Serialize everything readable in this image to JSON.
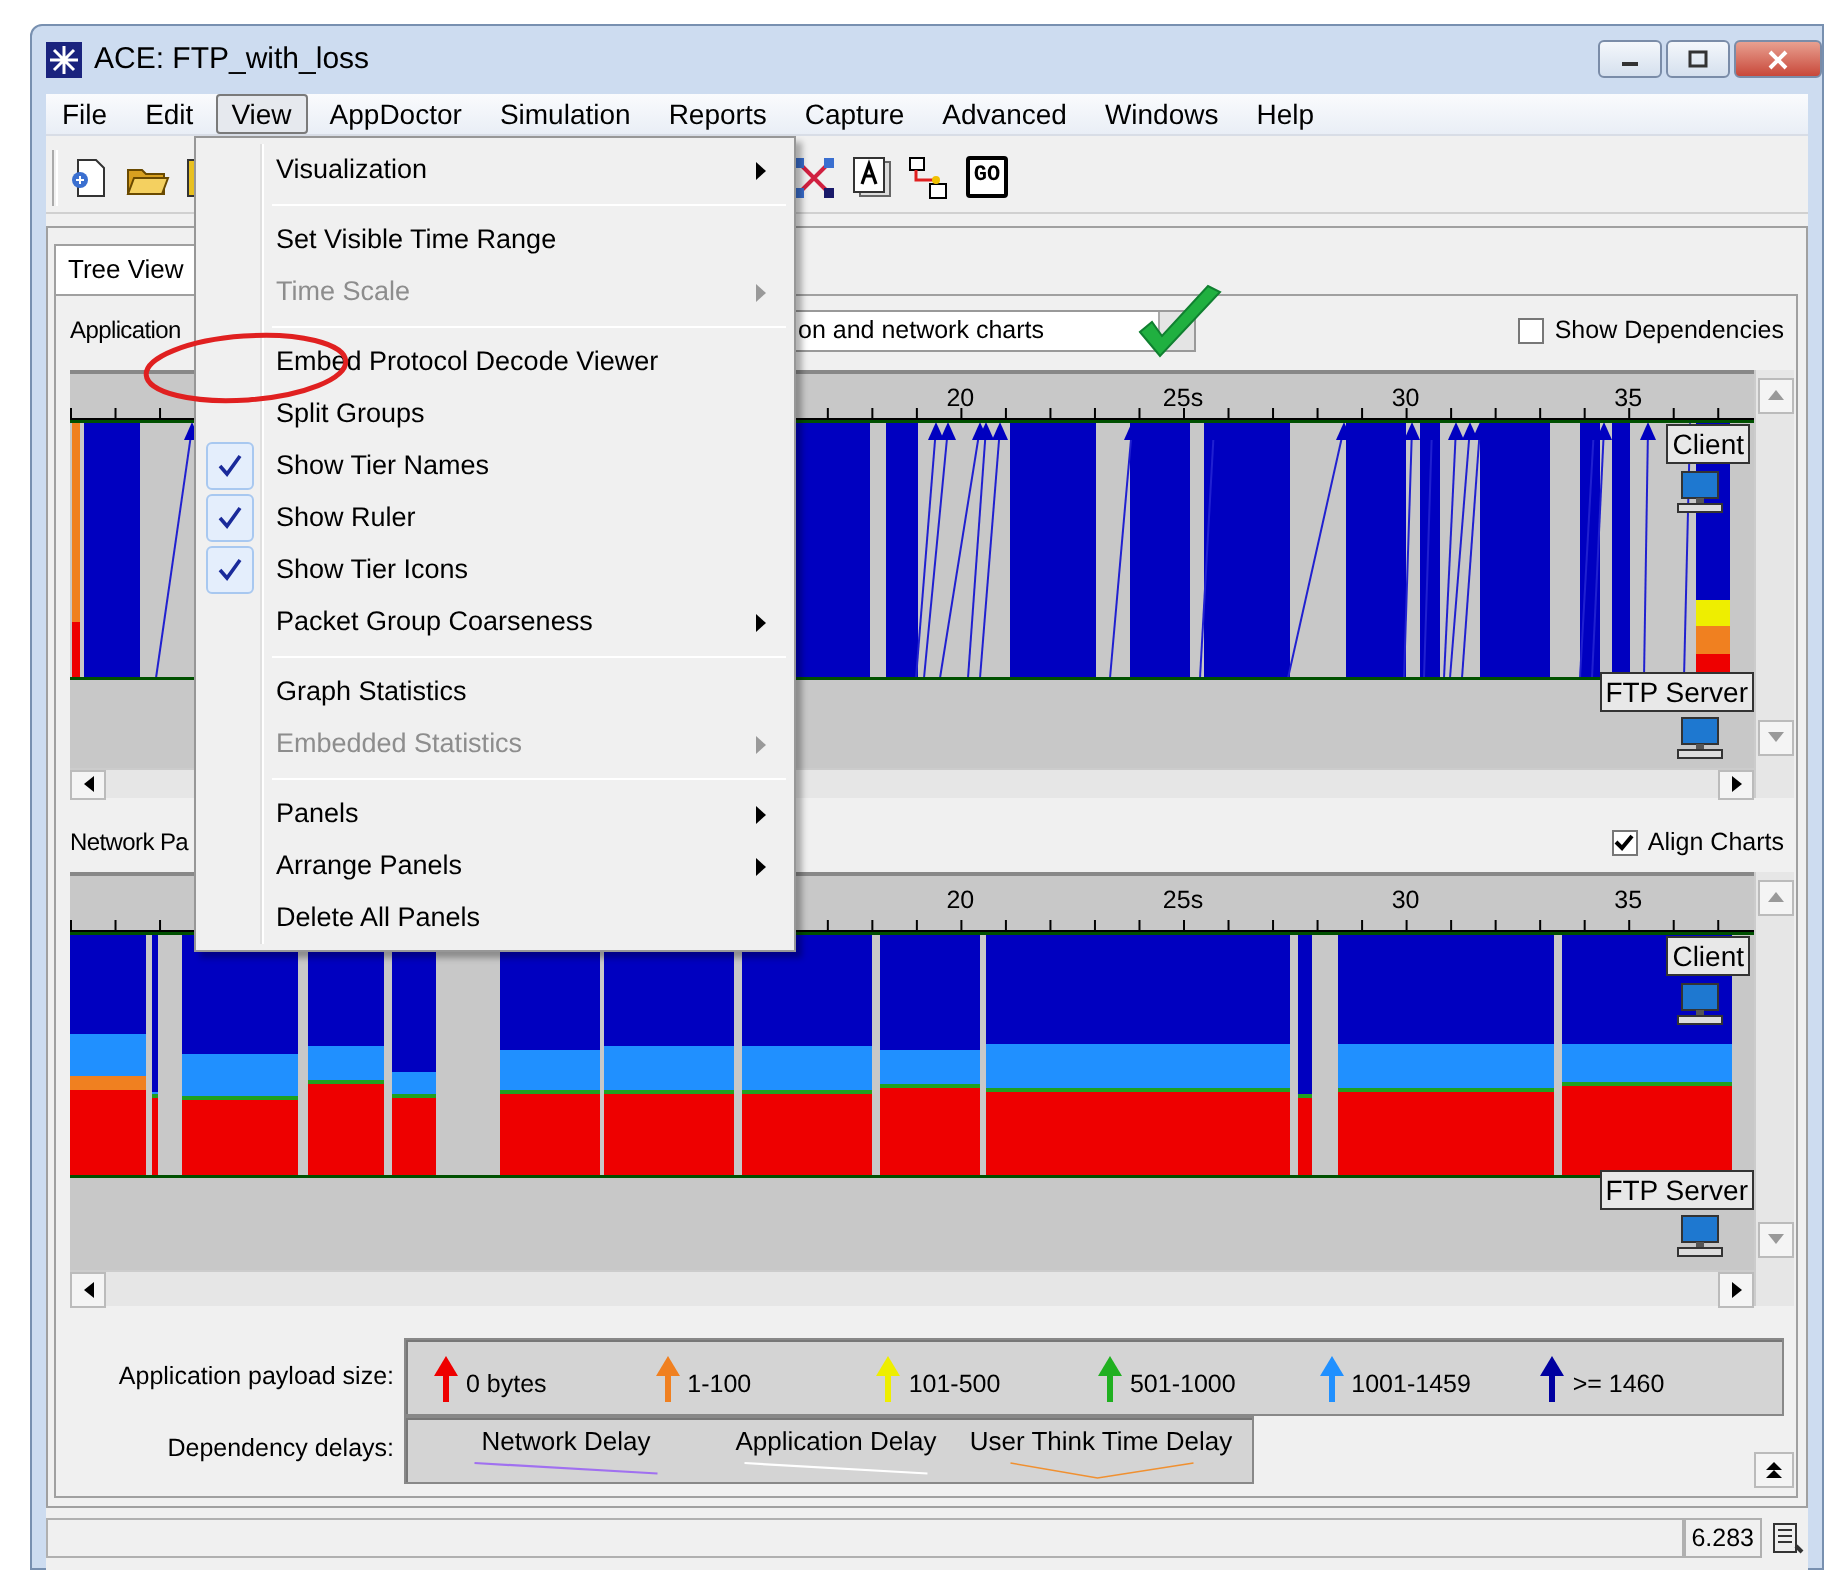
{
  "window": {
    "title": "ACE: FTP_with_loss"
  },
  "menu_bar": [
    {
      "label": "File",
      "selected": false
    },
    {
      "label": "Edit",
      "selected": false
    },
    {
      "label": "View",
      "selected": true
    },
    {
      "label": "AppDoctor",
      "selected": false
    },
    {
      "label": "Simulation",
      "selected": false
    },
    {
      "label": "Reports",
      "selected": false
    },
    {
      "label": "Capture",
      "selected": false
    },
    {
      "label": "Advanced",
      "selected": false
    },
    {
      "label": "Windows",
      "selected": false
    },
    {
      "label": "Help",
      "selected": false
    }
  ],
  "view_menu": {
    "groups": [
      [
        {
          "label": "Visualization",
          "checked": false,
          "disabled": false,
          "submenu": true
        }
      ],
      [
        {
          "label": "Set Visible Time Range",
          "checked": false,
          "disabled": false,
          "submenu": false
        },
        {
          "label": "Time Scale",
          "checked": false,
          "disabled": true,
          "submenu": true
        }
      ],
      [
        {
          "label": "Embed Protocol Decode Viewer",
          "checked": false,
          "disabled": false,
          "submenu": false
        },
        {
          "label": "Split Groups",
          "checked": false,
          "disabled": false,
          "submenu": false
        },
        {
          "label": "Show Tier Names",
          "checked": true,
          "disabled": false,
          "submenu": false
        },
        {
          "label": "Show Ruler",
          "checked": true,
          "disabled": false,
          "submenu": false
        },
        {
          "label": "Show Tier Icons",
          "checked": true,
          "disabled": false,
          "submenu": false
        },
        {
          "label": "Packet Group Coarseness",
          "checked": false,
          "disabled": false,
          "submenu": true
        }
      ],
      [
        {
          "label": "Graph Statistics",
          "checked": false,
          "disabled": false,
          "submenu": false
        },
        {
          "label": "Embedded Statistics",
          "checked": false,
          "disabled": true,
          "submenu": true
        }
      ],
      [
        {
          "label": "Panels",
          "checked": false,
          "disabled": false,
          "submenu": true
        },
        {
          "label": "Arrange Panels",
          "checked": false,
          "disabled": false,
          "submenu": true
        },
        {
          "label": "Delete All Panels",
          "checked": false,
          "disabled": false,
          "submenu": false
        }
      ]
    ]
  },
  "toolbar": {
    "go_label": "GO"
  },
  "tabs": [
    {
      "label": "Tree View",
      "selected": true
    }
  ],
  "application_panel": {
    "label": "Application",
    "dropdown_value": "on and network charts",
    "option": {
      "label": "Show Dependencies",
      "checked": false
    },
    "ruler_labels": [
      "20",
      "25s",
      "30",
      "35"
    ],
    "tiers": [
      "Client",
      "FTP Server"
    ]
  },
  "network_panel": {
    "label": "Network Pa",
    "option": {
      "label": "Align Charts",
      "checked": true
    },
    "ruler_labels": [
      "20",
      "25s",
      "30",
      "35"
    ],
    "tiers": [
      "Client",
      "FTP Server"
    ]
  },
  "payload_legend": {
    "label": "Application payload size:",
    "items": [
      {
        "label": "0 bytes",
        "color": "#ee0000"
      },
      {
        "label": "1-100",
        "color": "#f08020"
      },
      {
        "label": "101-500",
        "color": "#eeee00"
      },
      {
        "label": "501-1000",
        "color": "#20b020"
      },
      {
        "label": "1001-1459",
        "color": "#2090ff"
      },
      {
        "label": ">= 1460",
        "color": "#0000a0"
      }
    ]
  },
  "delay_legend": {
    "label": "Dependency delays:",
    "items": [
      {
        "label": "Network Delay",
        "color": "#a070f0"
      },
      {
        "label": "Application Delay",
        "color": "#ffffff"
      },
      {
        "label": "User Think Time Delay",
        "color": "#f09030"
      }
    ]
  },
  "status_bar": {
    "value": "6.283"
  }
}
